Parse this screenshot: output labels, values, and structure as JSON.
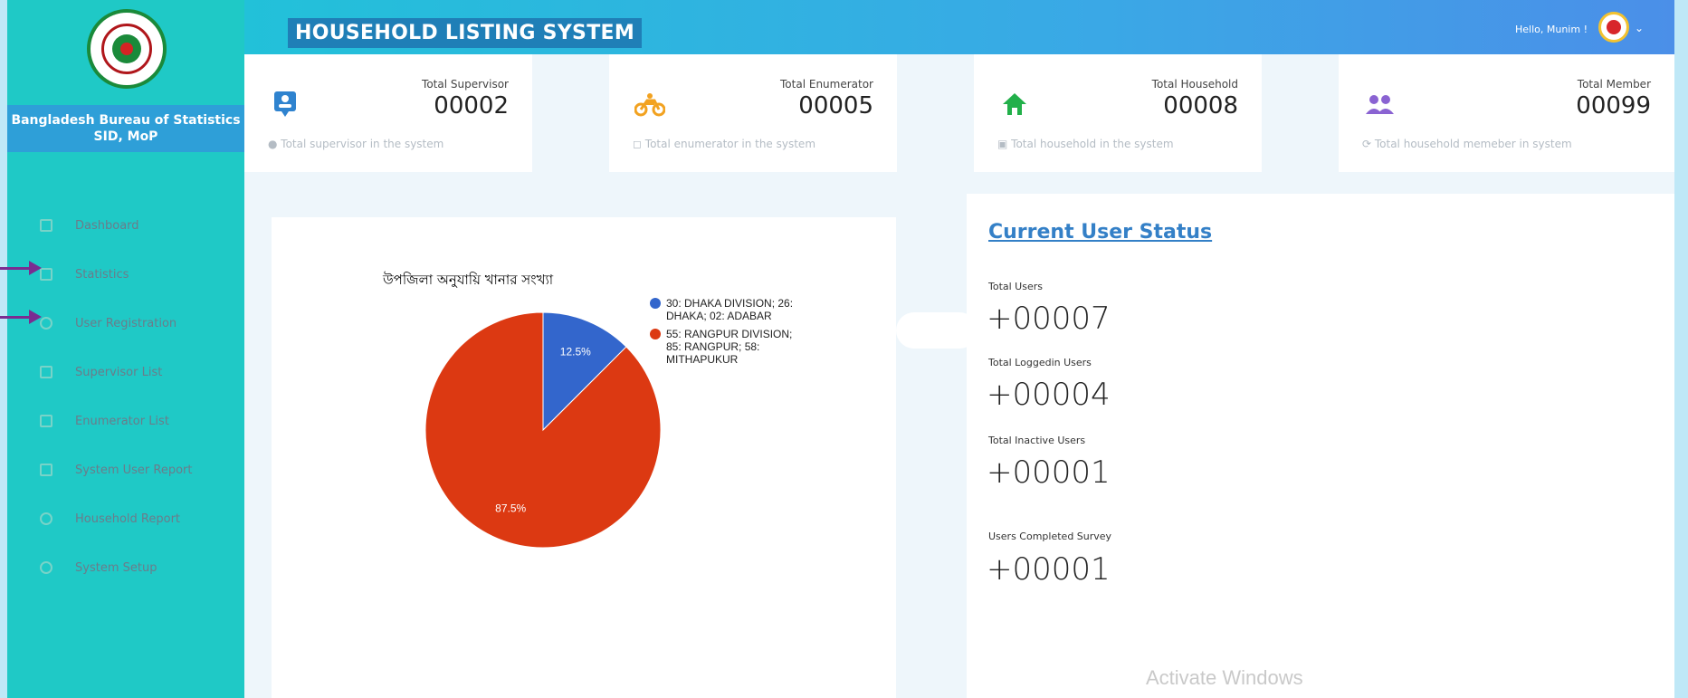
{
  "org": {
    "name_line1": "Bangladesh Bureau of Statistics",
    "name_line2": "SID, MoP"
  },
  "header": {
    "title": "HOUSEHOLD LISTING SYSTEM",
    "greeting": "Hello, Munim !"
  },
  "nav": [
    {
      "label": "Dashboard",
      "icon": "dashboard-icon"
    },
    {
      "label": "Statistics",
      "icon": "statistics-icon"
    },
    {
      "label": "User Registration",
      "icon": "user-registration-icon"
    },
    {
      "label": "Supervisor List",
      "icon": "list-icon"
    },
    {
      "label": "Enumerator List",
      "icon": "list-icon"
    },
    {
      "label": "System User Report",
      "icon": "report-icon"
    },
    {
      "label": "Household Report",
      "icon": "report-icon"
    },
    {
      "label": "System Setup",
      "icon": "gear-icon"
    }
  ],
  "cards": [
    {
      "label": "Total Supervisor",
      "value": "00002",
      "desc": "● Total supervisor in the system",
      "icon": "supervisor-icon",
      "color": "#2f83cf"
    },
    {
      "label": "Total Enumerator",
      "value": "00005",
      "desc": "◻ Total enumerator in the system",
      "icon": "motorbike-icon",
      "color": "#f2a220"
    },
    {
      "label": "Total Household",
      "value": "00008",
      "desc": "▣ Total household in the system",
      "icon": "home-icon",
      "color": "#22b04a"
    },
    {
      "label": "Total Member",
      "value": "00099",
      "desc": "⟳ Total household memeber in system",
      "icon": "group-icon",
      "color": "#8a63d2"
    }
  ],
  "chart": {
    "title": "উপজিলা অনুযায়ি খানার সংখ্যা"
  },
  "chart_data": {
    "type": "pie",
    "title": "উপজিলা অনুযায়ি খানার সংখ্যা",
    "slices": [
      {
        "label": "30: DHAKA DIVISION; 26: DHAKA; 02: ADABAR",
        "value": 12.5,
        "pct_label": "12.5%",
        "color": "#3366cc"
      },
      {
        "label": "55: RANGPUR DIVISION; 85: RANGPUR; 58: MITHAPUKUR",
        "value": 87.5,
        "pct_label": "87.5%",
        "color": "#dc3912"
      }
    ]
  },
  "status": {
    "title": "Current User Status",
    "items": [
      {
        "label": "Total Users",
        "value": "+00007"
      },
      {
        "label": "Total Loggedin Users",
        "value": "+00004"
      },
      {
        "label": "Total Inactive Users",
        "value": "+00001"
      },
      {
        "label": "Users Completed Survey",
        "value": "+00001"
      }
    ]
  },
  "watermark": "Activate Windows"
}
